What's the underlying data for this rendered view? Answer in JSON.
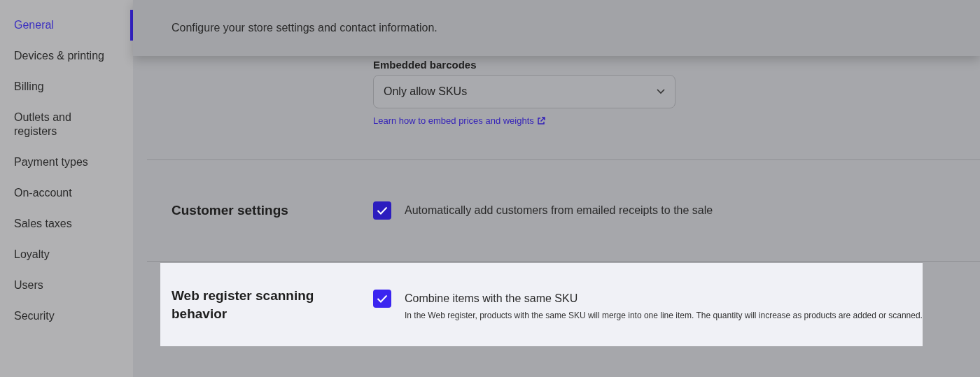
{
  "sidebar": {
    "items": [
      {
        "label": "General",
        "selected": true
      },
      {
        "label": "Devices & printing",
        "selected": false
      },
      {
        "label": "Billing",
        "selected": false
      },
      {
        "label": "Outlets and registers",
        "selected": false
      },
      {
        "label": "Payment types",
        "selected": false
      },
      {
        "label": "On-account",
        "selected": false
      },
      {
        "label": "Sales taxes",
        "selected": false
      },
      {
        "label": "Loyalty",
        "selected": false
      },
      {
        "label": "Users",
        "selected": false
      },
      {
        "label": "Security",
        "selected": false
      }
    ]
  },
  "header": {
    "description": "Configure your store settings and contact information."
  },
  "sections": [
    {
      "kind": "select",
      "label": "Embedded barcodes",
      "value": "Only allow SKUs",
      "link": "Learn how to embed prices and weights"
    },
    {
      "kind": "checkbox",
      "highlighted": false,
      "title": "Customer settings",
      "label": "Automatically add customers from emailed receipts to the sale",
      "checked": true
    },
    {
      "kind": "checkbox",
      "highlighted": true,
      "title": "Web register scanning behavior",
      "label": "Combine items with the same SKU",
      "help": "In the Web register, products with the same SKU will merge into one line item. The quantity will increase as products are added or scanned.",
      "checked": true
    }
  ]
}
